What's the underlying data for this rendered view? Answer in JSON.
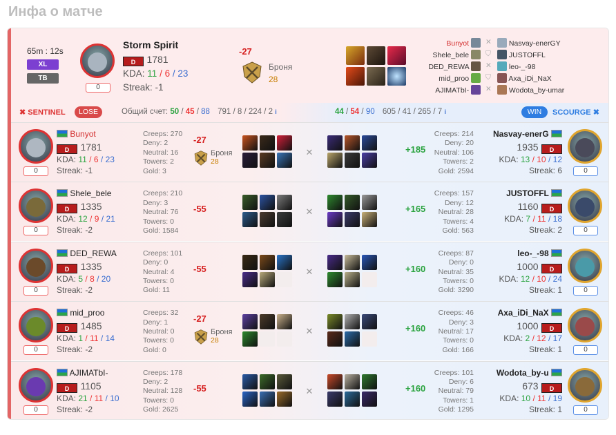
{
  "page": {
    "title": "Инфа о матче"
  },
  "summary": {
    "duration": "65m : 12s",
    "badge_xl": "XL",
    "badge_tb": "TB",
    "hero_name": "Storm Spirit",
    "rating": "1781",
    "kda_label": "KDA:",
    "kills": "11",
    "deaths": "6",
    "assists": "23",
    "streak": "Streak: -1",
    "pill": "0",
    "delta": "-27",
    "armor_label": "Броня",
    "armor_value": "28",
    "sep": "/",
    "radiant_names": [
      "Bunyot",
      "Shele_bele",
      "DED_REWA",
      "mid_proo",
      "AJIMATbI-"
    ],
    "dire_names": [
      "Nasvay-enerGY",
      "JUSTOFFL",
      "leo-_-98",
      "Axa_iDi_NaX",
      "Wodota_by-umar"
    ]
  },
  "scorebar": {
    "sentinel_label": "SENTINEL",
    "lose_label": "LOSE",
    "score_label": "Общий счет:",
    "s_k": "50",
    "s_d": "45",
    "s_a": "88",
    "s_rest": "791 / 8 / 224 / 2",
    "r_k": "44",
    "r_d": "54",
    "r_a": "90",
    "r_rest": "605 / 41 / 265 / 7",
    "win_label": "WIN",
    "scourge_label": "SCOURGE",
    "sep": "/",
    "info": "i"
  },
  "colors": {
    "accent": "#e36565",
    "lose": "#d94a4a",
    "win": "#2f7de1",
    "kills": "#2aa33f",
    "deaths": "#e33333",
    "assists": "#3a6ed0"
  },
  "rows": [
    {
      "left": {
        "name": "Bunyot",
        "name_color": "#d32f2f",
        "rating": "1781",
        "kills": "11",
        "deaths": "6",
        "assists": "23",
        "streak": "Streak: -1",
        "pill": "0",
        "stats": [
          "Creeps: 270",
          "Deny: 2",
          "Neutral: 16",
          "Towers: 2",
          "Gold: 3"
        ],
        "delta": "-27",
        "armor": true,
        "armor_label": "Броня",
        "armor_value": "28"
      },
      "right": {
        "name": "Nasvay-enerG",
        "rating": "1935",
        "kills": "13",
        "deaths": "10",
        "assists": "12",
        "streak": "Streak: 6",
        "pill": "0",
        "stats": [
          "Creeps: 214",
          "Deny: 20",
          "Neutral: 106",
          "Towers: 2",
          "Gold: 2594"
        ],
        "delta": "+185"
      }
    },
    {
      "left": {
        "name": "Shele_bele",
        "name_color": "#222222",
        "rating": "1335",
        "kills": "12",
        "deaths": "9",
        "assists": "21",
        "streak": "Streak: -2",
        "pill": "0",
        "stats": [
          "Creeps: 210",
          "Deny: 3",
          "Neutral: 76",
          "Towers: 0",
          "Gold: 1584"
        ],
        "delta": "-55",
        "armor": false
      },
      "right": {
        "name": "JUSTOFFL",
        "rating": "1160",
        "kills": "7",
        "deaths": "11",
        "assists": "18",
        "streak": "Streak: 2",
        "pill": "0",
        "stats": [
          "Creeps: 157",
          "Deny: 12",
          "Neutral: 28",
          "Towers: 4",
          "Gold: 563"
        ],
        "delta": "+165"
      }
    },
    {
      "left": {
        "name": "DED_REWA",
        "name_color": "#222222",
        "rating": "1335",
        "kills": "5",
        "deaths": "8",
        "assists": "20",
        "streak": "Streak: -2",
        "pill": "0",
        "stats": [
          "Creeps: 101",
          "Deny: 0",
          "Neutral: 4",
          "Towers: 0",
          "Gold: 11"
        ],
        "delta": "-55",
        "armor": false
      },
      "right": {
        "name": "leo-_-98",
        "rating": "1000",
        "kills": "12",
        "deaths": "10",
        "assists": "24",
        "streak": "Streak: 1",
        "pill": "0",
        "stats": [
          "Creeps: 87",
          "Deny: 0",
          "Neutral: 35",
          "Towers: 0",
          "Gold: 3290"
        ],
        "delta": "+160"
      }
    },
    {
      "left": {
        "name": "mid_proo",
        "name_color": "#222222",
        "rating": "1485",
        "kills": "1",
        "deaths": "11",
        "assists": "14",
        "streak": "Streak: -2",
        "pill": "0",
        "stats": [
          "Creeps: 32",
          "Deny: 1",
          "Neutral: 0",
          "Towers: 0",
          "Gold: 0"
        ],
        "delta": "-27",
        "armor": true,
        "armor_label": "Броня",
        "armor_value": "28"
      },
      "right": {
        "name": "Axa_iDi_NaX",
        "rating": "1000",
        "kills": "2",
        "deaths": "12",
        "assists": "17",
        "streak": "Streak: 1",
        "pill": "0",
        "stats": [
          "Creeps: 46",
          "Deny: 3",
          "Neutral: 17",
          "Towers: 0",
          "Gold: 166"
        ],
        "delta": "+160"
      }
    },
    {
      "left": {
        "name": "AJIMATbI-",
        "name_color": "#222222",
        "rating": "1105",
        "kills": "21",
        "deaths": "11",
        "assists": "10",
        "streak": "Streak: -2",
        "pill": "0",
        "stats": [
          "Creeps: 178",
          "Deny: 2",
          "Neutral: 128",
          "Towers: 0",
          "Gold: 2625"
        ],
        "delta": "-55",
        "armor": false
      },
      "right": {
        "name": "Wodota_by-u",
        "rating": "673",
        "kills": "10",
        "deaths": "11",
        "assists": "19",
        "streak": "Streak: 1",
        "pill": "0",
        "stats": [
          "Creeps: 101",
          "Deny: 6",
          "Neutral: 79",
          "Towers: 1",
          "Gold: 1295"
        ],
        "delta": "+160"
      }
    }
  ]
}
